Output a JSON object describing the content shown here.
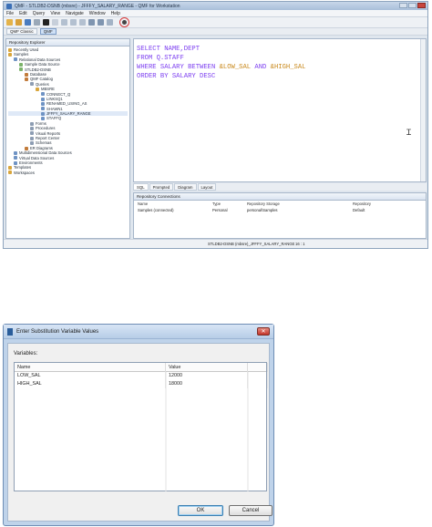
{
  "qmf": {
    "title": "QMF - STLDB2-DSNB (mbsre) - JFFFY_SALARY_RANGE - QMF for Workstation",
    "menu": [
      "File",
      "Edit",
      "Query",
      "View",
      "Navigate",
      "Window",
      "Help"
    ],
    "perspectives": [
      "QMF Classic",
      "QMF"
    ],
    "explorer_title": "Repository Explorer",
    "tree": [
      {
        "label": "Recently Used",
        "depth": 0
      },
      {
        "label": "Samples",
        "depth": 0
      },
      {
        "label": "Relational Data Sources",
        "depth": 1
      },
      {
        "label": "Sample Data Source",
        "depth": 2
      },
      {
        "label": "STLDB2-DSNB",
        "depth": 2
      },
      {
        "label": "Database",
        "depth": 3
      },
      {
        "label": "QMF Catalog",
        "depth": 3
      },
      {
        "label": "Queries",
        "depth": 4
      },
      {
        "label": "MBSRE",
        "depth": 5
      },
      {
        "label": "CONNECT_Q",
        "depth": 6
      },
      {
        "label": "LINKSQ1",
        "depth": 6
      },
      {
        "label": "RENAMED_USING_AS",
        "depth": 6
      },
      {
        "label": "SHAWN1",
        "depth": 6
      },
      {
        "label": "JFFFY_SALARY_RANGE",
        "depth": 6,
        "selected": true
      },
      {
        "label": "STAFFQ",
        "depth": 6
      },
      {
        "label": "Forms",
        "depth": 4
      },
      {
        "label": "Procedures",
        "depth": 4
      },
      {
        "label": "Visual Reports",
        "depth": 4
      },
      {
        "label": "Report Center",
        "depth": 4
      },
      {
        "label": "Schemas",
        "depth": 4
      },
      {
        "label": "ER Diagrams",
        "depth": 3
      },
      {
        "label": "Multidimensional Data Sources",
        "depth": 1
      },
      {
        "label": "Virtual Data Sources",
        "depth": 1
      },
      {
        "label": "Environments",
        "depth": 1
      },
      {
        "label": "Templates",
        "depth": 0
      },
      {
        "label": "Workspaces",
        "depth": 0
      }
    ],
    "sql": [
      [
        {
          "t": "SELECT NAME,DEPT",
          "c": "kw"
        }
      ],
      [
        {
          "t": "FROM Q.STAFF",
          "c": "kw"
        }
      ],
      [
        {
          "t": "WHERE SALARY BETWEEN ",
          "c": "kw"
        },
        {
          "t": "&LOW_SAL",
          "c": "var"
        },
        {
          "t": " AND ",
          "c": "kw"
        },
        {
          "t": "&HIGH_SAL",
          "c": "var"
        }
      ],
      [
        {
          "t": "ORDER BY SALARY DESC",
          "c": "kw"
        }
      ]
    ],
    "editor_tabs": [
      "SQL",
      "Prompted",
      "Diagram",
      "Layout"
    ],
    "connections": {
      "title": "Repository Connections",
      "headers": [
        "Name",
        "Type",
        "Repository Storage",
        "Repository"
      ],
      "rows": [
        [
          "Samples (connected)",
          "Personal",
          "personal\\Samples",
          "Default"
        ]
      ]
    },
    "status": {
      "object": "STLDB2-DSNB (mbsre)_JFFFY_SALARY_RANGE",
      "position": "16 : 1"
    },
    "highlight_color": "#d93a3a"
  },
  "dialog": {
    "title": "Enter Substitution Variable Values",
    "close_label": "✕",
    "variables_label": "Variables:",
    "headers": [
      "Name",
      "Value"
    ],
    "rows": [
      {
        "name": "LOW_SAL",
        "value": "12000"
      },
      {
        "name": "HIGH_SAL",
        "value": "18000"
      }
    ],
    "ok_label": "OK",
    "cancel_label": "Cancel"
  }
}
